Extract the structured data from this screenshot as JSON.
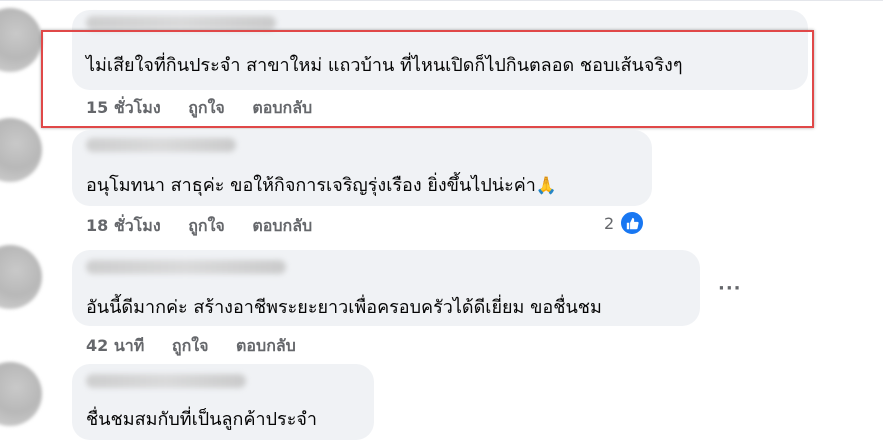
{
  "comments": [
    {
      "text": "ไม่เสียใจที่กินประจำ สาขาใหม่ แถวบ้าน ที่ไหนเปิดก็ไปกินตลอด ชอบเส้นจริงๆ",
      "time": "15 ชั่วโมง",
      "like_label": "ถูกใจ",
      "reply_label": "ตอบกลับ"
    },
    {
      "text": "อนุโมทนา สาธุค่ะ ขอให้กิจการเจริญรุ่งเรือง ยิ่งขึ้นไปน่ะค่า",
      "emoji": "🙏",
      "time": "18 ชั่วโมง",
      "like_label": "ถูกใจ",
      "reply_label": "ตอบกลับ",
      "reaction_count": "2"
    },
    {
      "text": "อันนี้ดีมากค่ะ สร้างอาชีพระยะยาวเพื่อครอบครัวได้ดีเยี่ยม ขอชื่นชม",
      "time": "42 นาที",
      "like_label": "ถูกใจ",
      "reply_label": "ตอบกลับ",
      "more_label": "···"
    },
    {
      "text": "ชื่นชมสมกับที่เป็นลูกค้าประจำ"
    }
  ],
  "colors": {
    "bubble": "#f0f2f5",
    "meta_text": "#65676b",
    "like_blue": "#1877f2",
    "highlight_border": "#e04848"
  }
}
